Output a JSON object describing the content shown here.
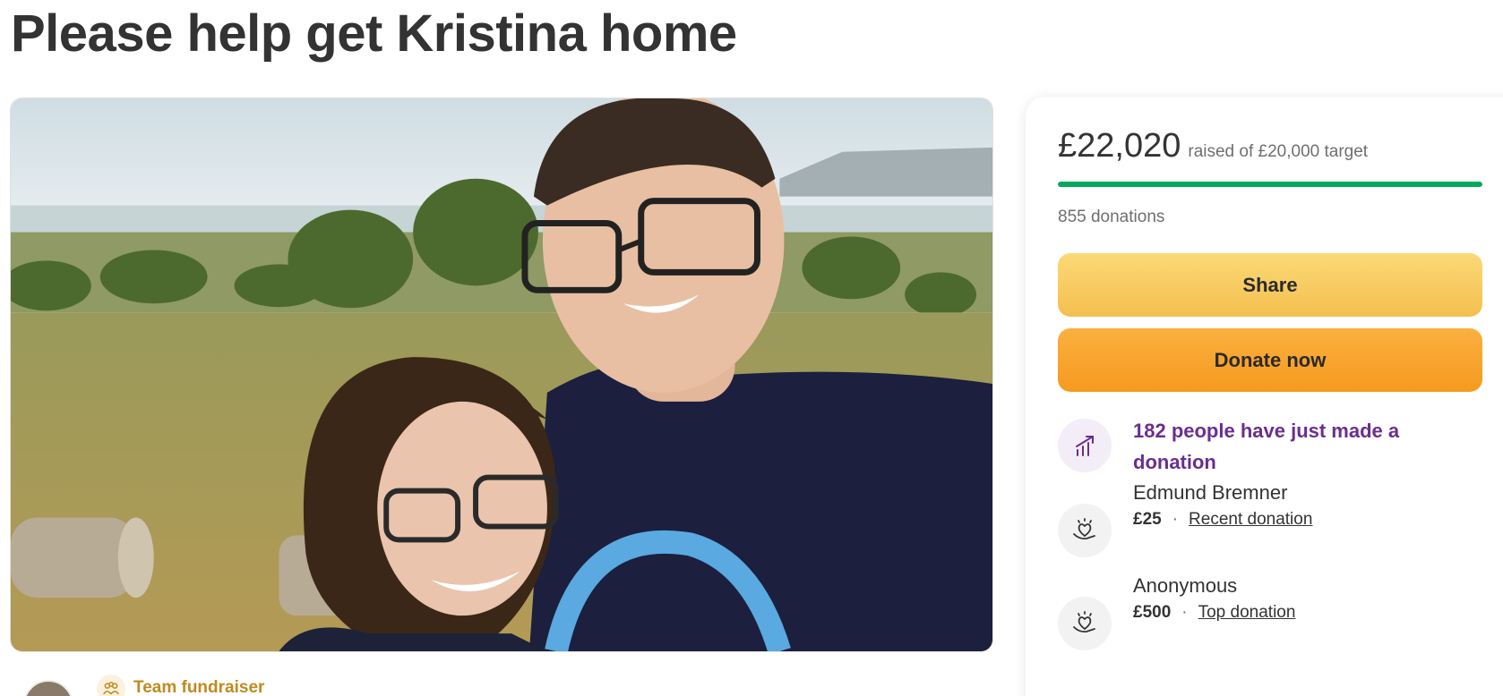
{
  "page": {
    "title": "Please help get Kristina home"
  },
  "hero": {
    "image_description_icon": "hero-photo"
  },
  "organizer": {
    "team_label": "Team fundraiser"
  },
  "panel": {
    "raised_amount": "£22,020",
    "target_text": "raised of £20,000 target",
    "progress_fraction": 1.0,
    "donations_count": "855 donations",
    "share_label": "Share",
    "donate_label": "Donate now",
    "trend_text": "182 people have just made a donation",
    "donors": [
      {
        "name": "Edmund Bremner",
        "amount": "£25",
        "tag": "Recent donation"
      },
      {
        "name": "Anonymous",
        "amount": "£500",
        "tag": "Top donation"
      }
    ]
  },
  "colors": {
    "progress_green": "#02a95c",
    "share_yellow": "#f4bf4f",
    "donate_orange": "#f59a1f",
    "trend_purple": "#6b2e8f",
    "team_gold": "#c08a1e"
  }
}
